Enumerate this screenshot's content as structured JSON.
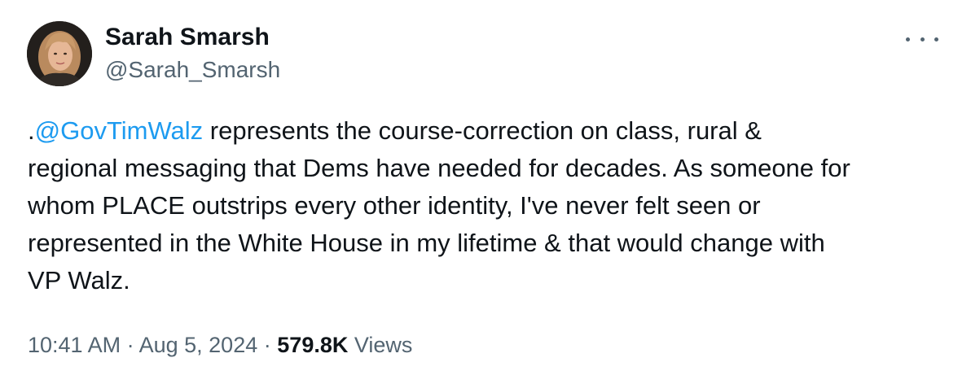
{
  "author": {
    "display_name": "Sarah Smarsh",
    "handle": "@Sarah_Smarsh",
    "avatar_icon": "profile-photo"
  },
  "more_icon": "more-horizontal-icon",
  "tweet": {
    "lines": [
      {
        "prefix": ".",
        "mention": "@GovTimWalz",
        "text": " represents the course-correction on class, rural &"
      },
      {
        "text": "regional messaging that Dems have needed for decades. As someone for"
      },
      {
        "text": "whom PLACE outstrips every other identity, I've never felt seen or"
      },
      {
        "text": "represented in the White House in my lifetime & that would change with"
      },
      {
        "text": "VP Walz."
      }
    ]
  },
  "meta": {
    "time": "10:41 AM",
    "separator": "·",
    "date": "Aug 5, 2024",
    "views_count": "579.8K",
    "views_label": "Views"
  },
  "colors": {
    "link": "#1d9bf0",
    "text": "#0f1419",
    "secondary": "#536471"
  }
}
